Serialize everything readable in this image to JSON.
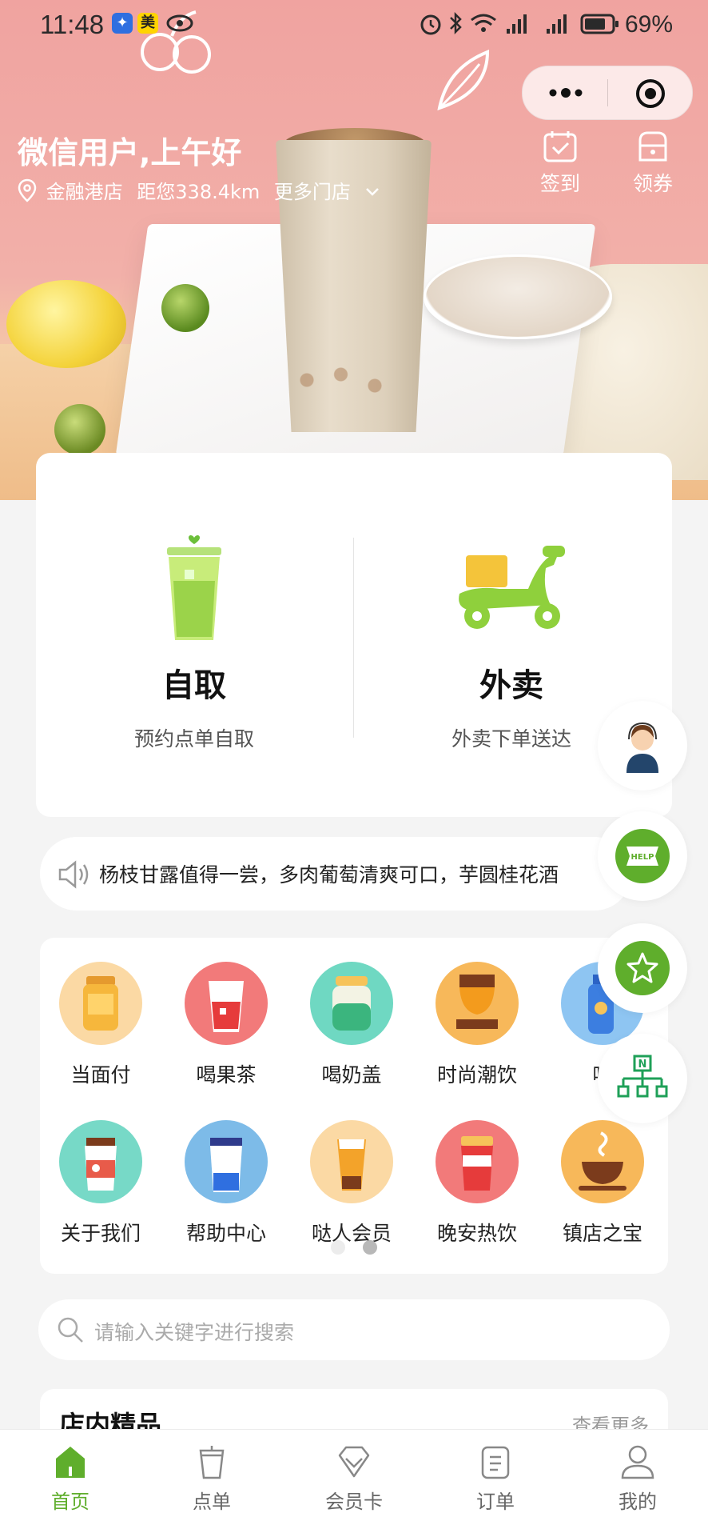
{
  "status_bar": {
    "time": "11:48",
    "badge_app": "美",
    "battery": "69%"
  },
  "header": {
    "greeting": "微信用户,上午好",
    "store_name": "金融港店",
    "distance": "距您338.4km",
    "more_stores": "更多门店",
    "actions": [
      {
        "label": "签到",
        "icon": "calendar-check-icon"
      },
      {
        "label": "领券",
        "icon": "coupon-icon"
      }
    ]
  },
  "order_modes": [
    {
      "title": "自取",
      "subtitle": "预约点单自取",
      "icon": "pickup-cup-icon"
    },
    {
      "title": "外卖",
      "subtitle": "外卖下单送达",
      "icon": "scooter-icon"
    }
  ],
  "notice": {
    "text": "杨枝甘露值得一尝，多肉葡萄清爽可口，芋圆桂花酒"
  },
  "shortcuts": [
    {
      "label": "当面付",
      "color": "#fbd9a4"
    },
    {
      "label": "喝果茶",
      "color": "#f27a7a"
    },
    {
      "label": "喝奶盖",
      "color": "#6fd8c2"
    },
    {
      "label": "时尚潮饮",
      "color": "#f7b85a"
    },
    {
      "label": "喝",
      "color": "#8ec5f2"
    },
    {
      "label": "关于我们",
      "color": "#77d9c7"
    },
    {
      "label": "帮助中心",
      "color": "#7dbbe8"
    },
    {
      "label": "哒人会员",
      "color": "#fbd9a4"
    },
    {
      "label": "晚安热饮",
      "color": "#f27a7a"
    },
    {
      "label": "镇店之宝",
      "color": "#f7b85a"
    }
  ],
  "search": {
    "placeholder": "请输入关键字进行搜索"
  },
  "section": {
    "title": "店内精品",
    "more": "查看更多"
  },
  "tabs": [
    {
      "label": "首页",
      "active": true
    },
    {
      "label": "点单",
      "active": false
    },
    {
      "label": "会员卡",
      "active": false
    },
    {
      "label": "订单",
      "active": false
    },
    {
      "label": "我的",
      "active": false
    }
  ],
  "accent": "#5fae2c"
}
